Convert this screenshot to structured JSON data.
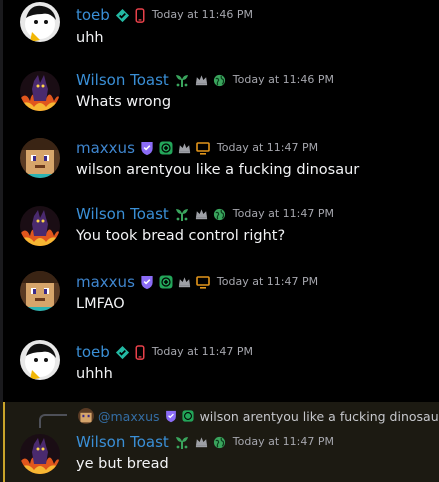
{
  "messages": [
    {
      "author": "toeb",
      "timestamp": "Today at 11:46 PM",
      "text": "uhh"
    },
    {
      "author": "Wilson Toast",
      "timestamp": "Today at 11:46 PM",
      "text": "Whats wrong"
    },
    {
      "author": "maxxus",
      "timestamp": "Today at 11:47 PM",
      "text": "wilson arentyou like a fucking dinosaur"
    },
    {
      "author": "Wilson Toast",
      "timestamp": "Today at 11:47 PM",
      "text": "You took bread control right?"
    },
    {
      "author": "maxxus",
      "timestamp": "Today at 11:47 PM",
      "text": "LMFAO"
    },
    {
      "author": "toeb",
      "timestamp": "Today at 11:47 PM",
      "text": "uhhh"
    },
    {
      "author": "Wilson Toast",
      "timestamp": "Today at 11:47 PM",
      "text": "ye but bread",
      "reply_to": {
        "author": "@maxxus",
        "text": "wilson arentyou like a fucking dinosaur"
      }
    }
  ],
  "colors": {
    "background": "#000000",
    "username_toeb": "#3a8fd6",
    "username_wilson": "#3a8fd6",
    "username_maxxus": "#3f86cf",
    "timestamp": "#a6a7ae",
    "message_text": "#f2f3f5",
    "mention_highlight": "#1c1a12",
    "mention_bar": "#c9a42a"
  },
  "icons": {
    "verified_badge": "diamond-check-icon",
    "mobile_badge": "mobile-phone-icon",
    "plant_badge": "sprout-icon",
    "crown_badge": "crown-icon",
    "globe_badge": "globe-icon",
    "shield_badge": "shield-icon",
    "controller_badge": "controller-icon",
    "monitor_badge": "monitor-icon"
  }
}
